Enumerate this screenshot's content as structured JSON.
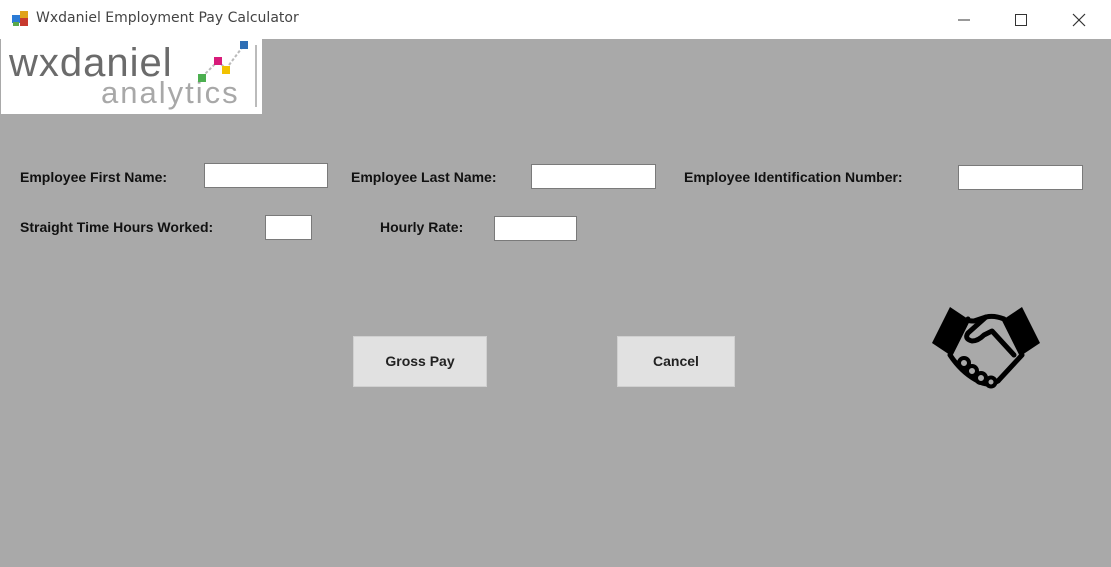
{
  "window": {
    "title": "Wxdaniel Employment Pay Calculator",
    "controls": [
      "minimize-icon",
      "maximize-icon",
      "close-icon"
    ]
  },
  "logo": {
    "main": "wxdaniel",
    "sub": "analytics"
  },
  "form": {
    "first_name_label": "Employee First Name:",
    "first_name_value": "",
    "last_name_label": "Employee Last Name:",
    "last_name_value": "",
    "id_label": "Employee Identification Number:",
    "id_value": "",
    "hours_label": "Straight Time Hours Worked:",
    "hours_value": "",
    "rate_label": "Hourly Rate:",
    "rate_value": ""
  },
  "buttons": {
    "gross_pay": "Gross Pay",
    "cancel": "Cancel"
  },
  "colors": {
    "background": "#a9a9a9",
    "button": "#e1e1e1"
  },
  "icons": [
    "app-icon",
    "handshake-icon"
  ]
}
